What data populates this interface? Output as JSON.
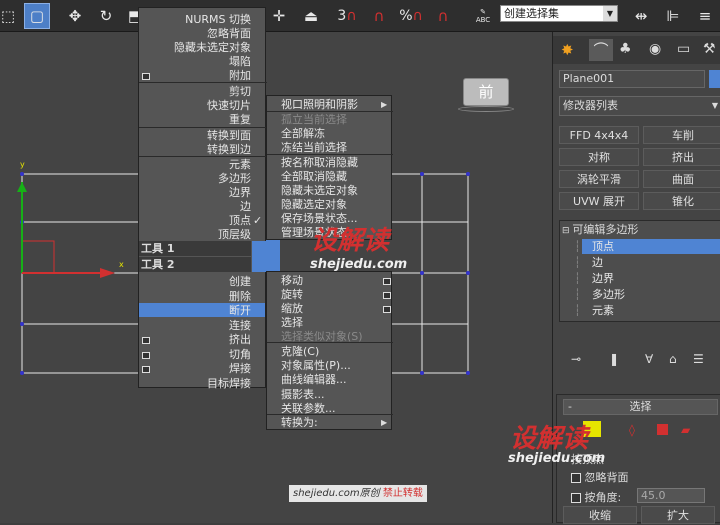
{
  "toolbar": {
    "dropdown_value": "创建选择集",
    "icons": [
      "select-icon",
      "move-icon",
      "rotate-icon",
      "snap-icon",
      "angle-snap-icon",
      "percent-snap-icon",
      "spinner-snap-icon",
      "abc-icon",
      "mirror-icon",
      "align-icon"
    ],
    "snap_labels": {
      "three": "3",
      "percent": "%",
      "abc": "ABC"
    }
  },
  "viewport": {
    "cube_label": "前",
    "axis_x": "x",
    "axis_y": "y"
  },
  "quad_right": {
    "items": [
      {
        "label": "NURMS 切换",
        "checkbox": false
      },
      {
        "label": "忽略背面",
        "checkbox": false
      },
      {
        "label": "隐藏未选定对象",
        "checkbox": false
      },
      {
        "label": "塌陷",
        "checkbox": false
      },
      {
        "label": "附加",
        "checkbox": true
      },
      {
        "label": "剪切",
        "checkbox": false
      },
      {
        "label": "快速切片",
        "checkbox": false
      },
      {
        "label": "重复",
        "checkbox": false
      },
      {
        "label": "转换到面",
        "checkbox": false
      },
      {
        "label": "转换到边",
        "checkbox": false
      },
      {
        "label": "元素",
        "checkbox": false
      },
      {
        "label": "多边形",
        "checkbox": false
      },
      {
        "label": "边界",
        "checkbox": false
      },
      {
        "label": "边",
        "checkbox": false
      },
      {
        "label": "顶点",
        "checkbox": false,
        "check": "✓"
      },
      {
        "label": "顶层级",
        "checkbox": false
      }
    ],
    "tool1": "工具 1",
    "tool2": "工具 2",
    "bottom": [
      {
        "label": "创建",
        "checkbox": false
      },
      {
        "label": "删除",
        "checkbox": false
      },
      {
        "label": "断开",
        "checkbox": false,
        "highlighted": true
      },
      {
        "label": "连接",
        "checkbox": false
      },
      {
        "label": "挤出",
        "checkbox": true
      },
      {
        "label": "切角",
        "checkbox": true
      },
      {
        "label": "焊接",
        "checkbox": true
      },
      {
        "label": "目标焊接",
        "checkbox": false
      }
    ]
  },
  "quad_left": {
    "top": [
      {
        "label": "视口照明和阴影",
        "sub": true,
        "disabled": false
      },
      {
        "label": "孤立当前选择",
        "disabled": true
      },
      {
        "label": "全部解冻",
        "disabled": false
      },
      {
        "label": "冻结当前选择",
        "disabled": false
      },
      {
        "label": "按名称取消隐藏",
        "disabled": false
      },
      {
        "label": "全部取消隐藏",
        "disabled": false
      },
      {
        "label": "隐藏未选定对象",
        "disabled": false
      },
      {
        "label": "隐藏选定对象",
        "disabled": false
      },
      {
        "label": "保存场景状态...",
        "disabled": false
      },
      {
        "label": "管理场景状态...",
        "disabled": false
      }
    ],
    "bottom": [
      {
        "label": "移动",
        "cb": true
      },
      {
        "label": "旋转",
        "cb": true
      },
      {
        "label": "缩放",
        "cb": true
      },
      {
        "label": "选择",
        "cb": false
      },
      {
        "label": "选择类似对象(S)",
        "cb": false,
        "disabled": true
      },
      {
        "label": "克隆(C)",
        "cb": false
      },
      {
        "label": "对象属性(P)...",
        "cb": false
      },
      {
        "label": "曲线编辑器...",
        "cb": false
      },
      {
        "label": "摄影表...",
        "cb": false
      },
      {
        "label": "关联参数...",
        "cb": false
      },
      {
        "label": "转换为:",
        "cb": false,
        "sub": true
      }
    ]
  },
  "panel": {
    "object_name": "Plane001",
    "modifier_list": "修改器列表",
    "buttons": [
      [
        "FFD 4x4x4",
        "车削"
      ],
      [
        "对称",
        "挤出"
      ],
      [
        "涡轮平滑",
        "曲面"
      ],
      [
        "UVW 展开",
        "锥化"
      ]
    ],
    "stack": {
      "root": "可编辑多边形",
      "items": [
        "顶点",
        "边",
        "边界",
        "多边形",
        "元素"
      ]
    },
    "selection": {
      "title": "选择",
      "by_vertex": "按顶点",
      "ignore_back": "忽略背面",
      "by_angle": "按角度:",
      "angle_value": "45.0",
      "shrink": "收缩",
      "grow": "扩大"
    }
  },
  "watermark": {
    "brand": "设解读",
    "url": "shejiedu.com",
    "notice_url": "shejiedu.com原创",
    "notice_warn": "禁止转载"
  },
  "colors": {
    "highlight": "#4f84d3",
    "accent_red": "#d23030"
  }
}
